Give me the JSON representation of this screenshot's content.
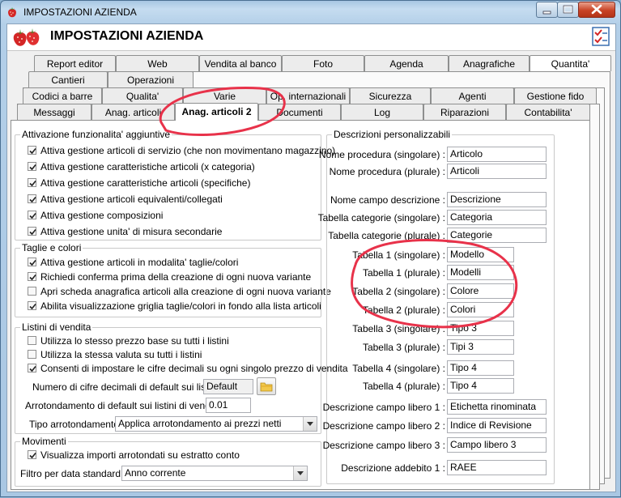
{
  "window": {
    "title": "IMPOSTAZIONI AZIENDA"
  },
  "header": {
    "title": "IMPOSTAZIONI AZIENDA"
  },
  "tabs": {
    "row1": [
      "Report editor",
      "Web",
      "Vendita al banco",
      "Foto",
      "Agenda",
      "Anagrafiche",
      "Quantita'"
    ],
    "row2": [
      "Cantieri",
      "Operazioni"
    ],
    "row3": [
      "Codici a barre",
      "Qualita'",
      "Varie",
      "Op. internazionali",
      "Sicurezza",
      "Agenti",
      "Gestione fido"
    ],
    "row4": [
      "Messaggi",
      "Anag. articoli",
      "Anag. articoli 2",
      "Documenti",
      "Log",
      "Riparazioni",
      "Contabilita'"
    ]
  },
  "attivazione": {
    "legend": "Attivazione funzionalita' aggiuntive",
    "items": [
      "Attiva gestione articoli di servizio (che non movimentano magazzino)",
      "Attiva gestione caratteristiche articoli (x categoria)",
      "Attiva gestione caratteristiche articoli (specifiche)",
      "Attiva gestione articoli equivalenti/collegati",
      "Attiva gestione composizioni",
      "Attiva gestione unita' di misura secondarie"
    ]
  },
  "taglie": {
    "legend": "Taglie e colori",
    "items": [
      {
        "label": "Attiva gestione articoli in modalita' taglie/colori",
        "checked": true
      },
      {
        "label": "Richiedi conferma prima della creazione di ogni nuova variante",
        "checked": true
      },
      {
        "label": "Apri scheda anagrafica articoli alla creazione di ogni nuova variante",
        "checked": false
      },
      {
        "label": "Abilita visualizzazione griglia taglie/colori in fondo alla lista articoli",
        "checked": true
      }
    ]
  },
  "listini": {
    "legend": "Listini di vendita",
    "items": [
      {
        "label": "Utilizza lo stesso prezzo base su tutti i listini",
        "checked": false
      },
      {
        "label": "Utilizza la stessa valuta su tutti i listini",
        "checked": false
      },
      {
        "label": "Consenti di impostare le cifre decimali su ogni singolo prezzo di vendita",
        "checked": true
      }
    ],
    "decimali_label": "Numero di cifre decimali di default sui listini :",
    "decimali_value": "Default",
    "arrotondamento_label": "Arrotondamento di default sui listini di vendita :",
    "arrotondamento_value": "0.01",
    "tipo_label": "Tipo arrotondamento :",
    "tipo_value": "Applica arrotondamento ai prezzi netti"
  },
  "movimenti": {
    "legend": "Movimenti",
    "check_label": "Visualizza importi arrotondati su estratto conto",
    "filtro_label": "Filtro per data standard :",
    "filtro_value": "Anno corrente"
  },
  "descrizioni": {
    "legend": "Descrizioni personalizzabili",
    "fields": [
      {
        "label": "Nome procedura (singolare) :",
        "value": "Articolo"
      },
      {
        "label": "Nome procedura (plurale) :",
        "value": "Articoli"
      },
      {
        "label": "Nome campo descrizione :",
        "value": "Descrizione"
      },
      {
        "label": "Tabella categorie (singolare) :",
        "value": "Categoria"
      },
      {
        "label": "Tabella categorie (plurale) :",
        "value": "Categorie"
      },
      {
        "label": "Tabella 1 (singolare) :",
        "value": "Modello"
      },
      {
        "label": "Tabella 1 (plurale) :",
        "value": "Modelli"
      },
      {
        "label": "Tabella 2 (singolare) :",
        "value": "Colore"
      },
      {
        "label": "Tabella 2 (plurale) :",
        "value": "Colori"
      },
      {
        "label": "Tabella 3 (singolare) :",
        "value": "Tipo 3"
      },
      {
        "label": "Tabella 3 (plurale) :",
        "value": "Tipi 3"
      },
      {
        "label": "Tabella 4 (singolare) :",
        "value": "Tipo 4"
      },
      {
        "label": "Tabella 4 (plurale) :",
        "value": "Tipo 4"
      },
      {
        "label": "Descrizione campo libero 1 :",
        "value": "Etichetta rinominata"
      },
      {
        "label": "Descrizione campo libero 2 :",
        "value": "Indice di Revisione"
      },
      {
        "label": "Descrizione campo libero 3 :",
        "value": "Campo libero 3"
      },
      {
        "label": "Descrizione addebito 1 :",
        "value": "RAEE"
      }
    ]
  },
  "colors": {
    "annotation": "#e8324a",
    "accent": "#3a7bd5"
  }
}
